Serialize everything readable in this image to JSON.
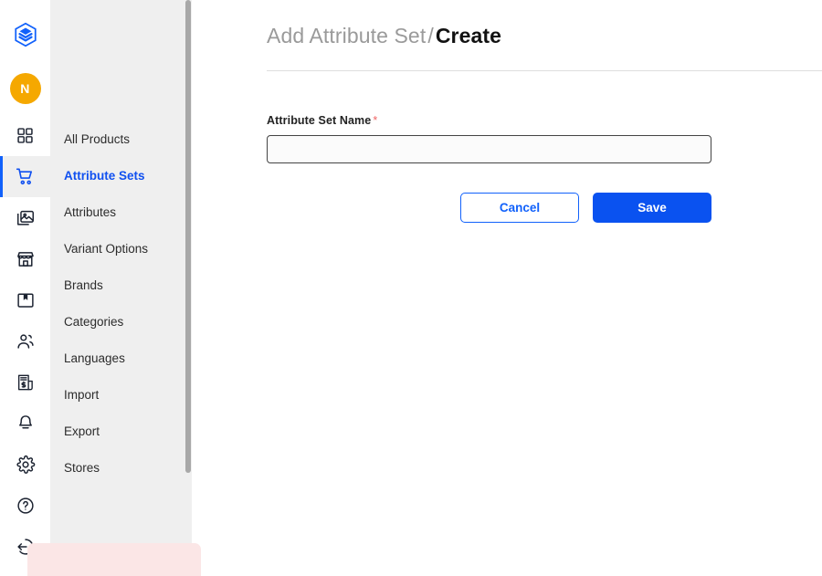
{
  "app": {
    "logo_icon": "cube-layers-logo-icon",
    "accent_blue": "#0a52f0",
    "active_blue": "#1161fb",
    "avatar_color": "#f5a800",
    "required_color": "#f06565"
  },
  "icon_rail": {
    "avatar_initial": "N",
    "items": [
      {
        "icon": "grid-apps-icon",
        "label": "Dashboard",
        "active": false
      },
      {
        "icon": "shopping-cart-icon",
        "label": "Products",
        "active": true
      },
      {
        "icon": "image-gallery-icon",
        "label": "Media",
        "active": false
      },
      {
        "icon": "storefront-icon",
        "label": "Store",
        "active": false
      },
      {
        "icon": "package-box-icon",
        "label": "Orders",
        "active": false
      },
      {
        "icon": "users-icon",
        "label": "Customers",
        "active": false
      },
      {
        "icon": "invoice-dollar-icon",
        "label": "Invoices",
        "active": false
      },
      {
        "icon": "bell-icon",
        "label": "Notifications",
        "active": false
      },
      {
        "icon": "gear-icon",
        "label": "Settings",
        "active": false
      },
      {
        "icon": "question-circle-icon",
        "label": "Help",
        "active": false
      },
      {
        "icon": "logout-circle-icon",
        "label": "Logout",
        "active": false
      }
    ]
  },
  "subnav": {
    "items": [
      {
        "label": "All Products",
        "active": false
      },
      {
        "label": "Attribute Sets",
        "active": true
      },
      {
        "label": "Attributes",
        "active": false
      },
      {
        "label": "Variant Options",
        "active": false
      },
      {
        "label": "Brands",
        "active": false
      },
      {
        "label": "Categories",
        "active": false
      },
      {
        "label": "Languages",
        "active": false
      },
      {
        "label": "Import",
        "active": false
      },
      {
        "label": "Export",
        "active": false
      },
      {
        "label": "Stores",
        "active": false
      }
    ]
  },
  "main": {
    "breadcrumb_parent": "Add Attribute Set",
    "breadcrumb_separator": "/",
    "breadcrumb_current": "Create",
    "form": {
      "name_label": "Attribute Set Name",
      "required_marker": "*",
      "name_value": "",
      "name_placeholder": ""
    },
    "buttons": {
      "cancel_label": "Cancel",
      "save_label": "Save"
    }
  }
}
